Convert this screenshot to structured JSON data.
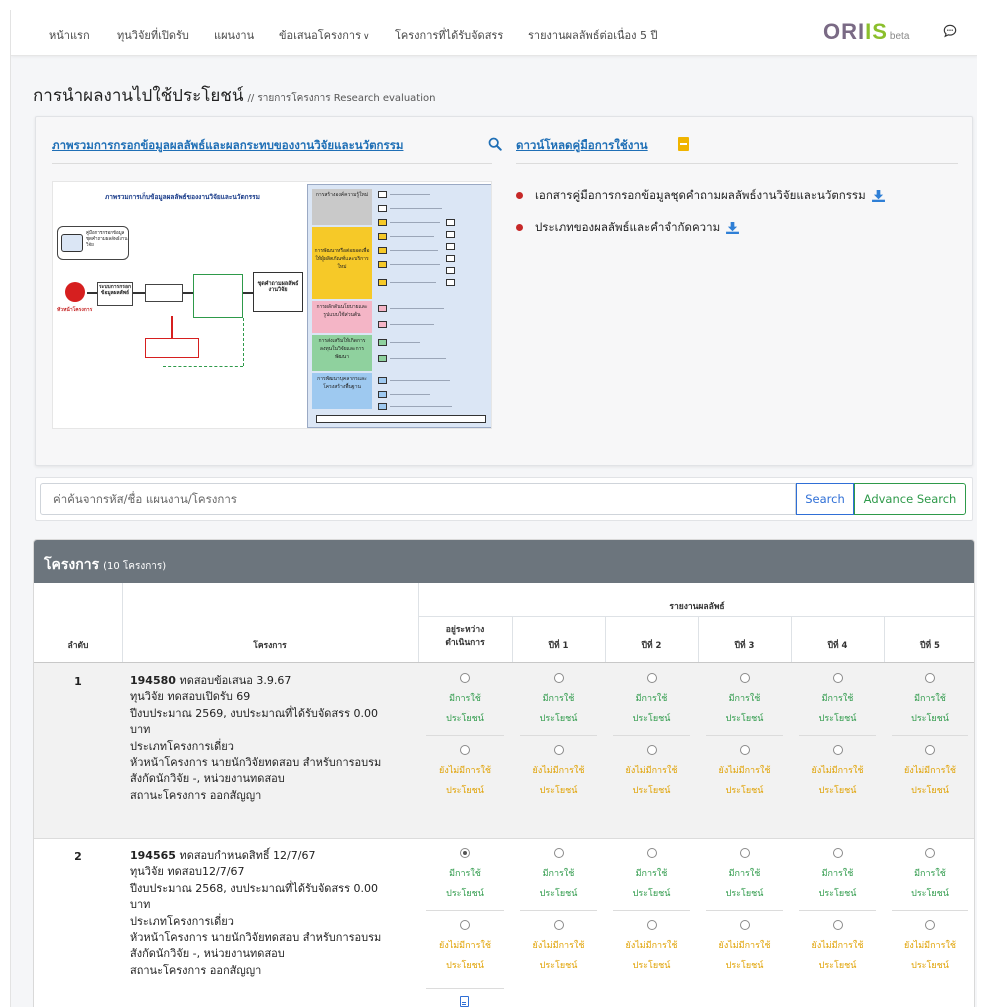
{
  "nav": {
    "items": [
      "หน้าแรก",
      "ทุนวิจัยที่เปิดรับ",
      "แผนงาน",
      "ข้อเสนอโครงการ",
      "โครงการที่ได้รับจัดสรร",
      "รายงานผลลัพธ์ต่อเนื่อง 5 ปี"
    ],
    "logo_ori": "ORI",
    "logo_is": "IS",
    "logo_beta": "beta",
    "icons": [
      "chevron-down-icon",
      "chat-icon"
    ]
  },
  "page": {
    "title": "การนำผลงานไปใช้ประโยชน์",
    "subtitle": "// รายการโครงการ Research evaluation"
  },
  "info": {
    "overview_title": "ภาพรวมการกรอกข้อมูลผลลัพธ์และผลกระทบของงานวิจัยและนวัตกรรม",
    "download_title": "ดาวน์โหลดคู่มือการใช้งาน",
    "docs": [
      "เอกสารคู่มือการกรอกข้อมูลชุดคำถามผลลัพธ์งานวิจัยและนวัตกรรม",
      "ประเภทของผลลัพธ์และคำจำกัดความ"
    ],
    "diagram": {
      "title": "ภาพรวมการเก็บข้อมูลผลลัพธ์ของงานวิจัยและนวัตกรรม",
      "manual": "คู่มือการกรอกข้อมูลชุดคำถามผลลัพธ์งานวิจัย",
      "leader": "หัวหน้าโครงการ",
      "system": "ระบบการกรอกข้อมูลผลลัพธ์",
      "result_set": "ชุดคำถามผลลัพธ์งานวิจัย",
      "categories": [
        "การสร้างองค์ความรู้ใหม่",
        "การพัฒนาหรือต่อยอดเพื่อให้ผู้ผลิตภัณฑ์และบริการใหม่",
        "การผลักดันนโยบายและรูปแบบใช้ส่วนต้น",
        "การส่งเสริมให้เกิดการลงทุนในวิจัยและการพัฒนา",
        "การพัฒนาบุคลากรและโครงสร้างพื้นฐาน"
      ]
    },
    "icons": [
      "search-icon",
      "book-icon",
      "download-icon"
    ]
  },
  "search": {
    "placeholder": "ค่าค้นจากรหัส/ชื่อ แผนงาน/โครงการ",
    "search_label": "Search",
    "advance_label": "Advance Search"
  },
  "projects": {
    "title": "โครงการ",
    "count": "(10 โครงการ)",
    "headers": {
      "report_group": "รายงานผลลัพธ์",
      "no": "ลำดับ",
      "project": "โครงการ",
      "in_progress_1": "อยู่ระหว่าง",
      "in_progress_2": "ดำเนินการ",
      "years": [
        "ปีที่ 1",
        "ปีที่ 2",
        "ปีที่ 3",
        "ปีที่ 4",
        "ปีที่ 5"
      ]
    },
    "labels": {
      "used_1": "มีการใช้",
      "used_2": "ประโยชน์",
      "unused_1": "ยังไม่มีการใช้",
      "unused_2": "ประโยชน์"
    },
    "rows": [
      {
        "no": "1",
        "code": "194580",
        "name": "ทดสอบข้อเสนอ 3.9.67",
        "line2": "ทุนวิจัย ทดสอบเปิดรับ 69",
        "line3": "ปีงบประมาณ 2569, งบประมาณที่ได้รับจัดสรร 0.00",
        "line4": "บาท",
        "line5": "ประเภทโครงการเดี่ยว",
        "line6": "หัวหน้าโครงการ นายนักวิจัยทดสอบ สำหรับการอบรม",
        "line7": "สังกัดนักวิจัย -, หน่วยงานทดสอบ",
        "line8": "สถานะโครงการ ออกสัญญา",
        "selected": "none"
      },
      {
        "no": "2",
        "code": "194565",
        "name": "ทดสอบกำหนดสิทธิ์ 12/7/67",
        "line2": "ทุนวิจัย ทดสอบ12/7/67",
        "line3": "ปีงบประมาณ 2568, งบประมาณที่ได้รับจัดสรร 0.00",
        "line4": "บาท",
        "line5": "ประเภทโครงการเดี่ยว",
        "line6": "หัวหน้าโครงการ นายนักวิจัยทดสอบ สำหรับการอบรม",
        "line7": "สังกัดนักวิจัย -, หน่วยงานทดสอบ",
        "line8": "สถานะโครงการ ออกสัญญา",
        "selected": "in-progress-used"
      }
    ],
    "colors": {
      "used": "#2e9a4a",
      "unused": "#e0a100",
      "header_bg": "#6c757d"
    }
  }
}
